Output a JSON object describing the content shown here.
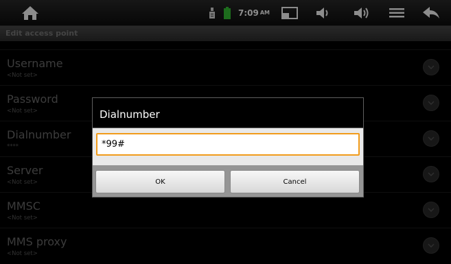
{
  "status_bar": {
    "time": "7:09",
    "ampm": "AM",
    "icons": [
      "home-icon",
      "usb-icon",
      "battery-icon",
      "screen-icon",
      "volume-down-icon",
      "volume-up-icon",
      "menu-icon",
      "back-icon"
    ],
    "battery_color": "#36c736"
  },
  "title_bar": {
    "title": "Edit access point"
  },
  "list": {
    "items": [
      {
        "title": "Username",
        "summary": "<Not set>"
      },
      {
        "title": "Password",
        "summary": "<Not set>"
      },
      {
        "title": "Dialnumber",
        "summary": "****"
      },
      {
        "title": "Server",
        "summary": "<Not set>"
      },
      {
        "title": "MMSC",
        "summary": "<Not set>"
      },
      {
        "title": "MMS proxy",
        "summary": "<Not set>"
      }
    ]
  },
  "dialog": {
    "title": "Dialnumber",
    "input_value": "*99#",
    "ok_label": "OK",
    "cancel_label": "Cancel",
    "focus_color": "#f19b1a"
  }
}
